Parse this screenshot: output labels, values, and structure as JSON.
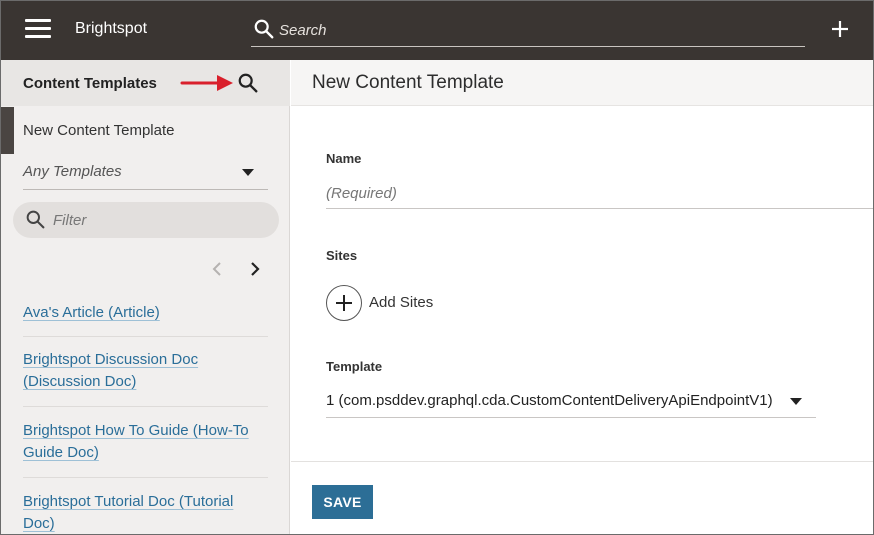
{
  "topbar": {
    "menu_icon": "hamburger-icon",
    "brand": "Brightspot",
    "search_placeholder": "Search",
    "add_icon": "plus-icon"
  },
  "sidebar": {
    "title": "Content Templates",
    "search_icon": "search-icon",
    "selected_item": "New Content Template",
    "template_filter": "Any Templates",
    "filter_placeholder": "Filter",
    "items": [
      {
        "label": "Ava's Article (Article)"
      },
      {
        "label": "Brightspot Discussion Doc (Discussion Doc)"
      },
      {
        "label": "Brightspot How To Guide (How-To Guide Doc)"
      },
      {
        "label": "Brightspot Tutorial Doc (Tutorial Doc)"
      }
    ]
  },
  "main": {
    "title": "New Content Template",
    "name": {
      "label": "Name",
      "placeholder": "(Required)"
    },
    "sites": {
      "label": "Sites",
      "add_label": "Add Sites"
    },
    "template": {
      "label": "Template",
      "value": "1 (com.psddev.graphql.cda.CustomContentDeliveryApiEndpointV1)"
    },
    "save_label": "SAVE"
  },
  "colors": {
    "topbar": "#3a3532",
    "accent": "#2c6e96",
    "annotation_arrow": "#d9202c"
  }
}
